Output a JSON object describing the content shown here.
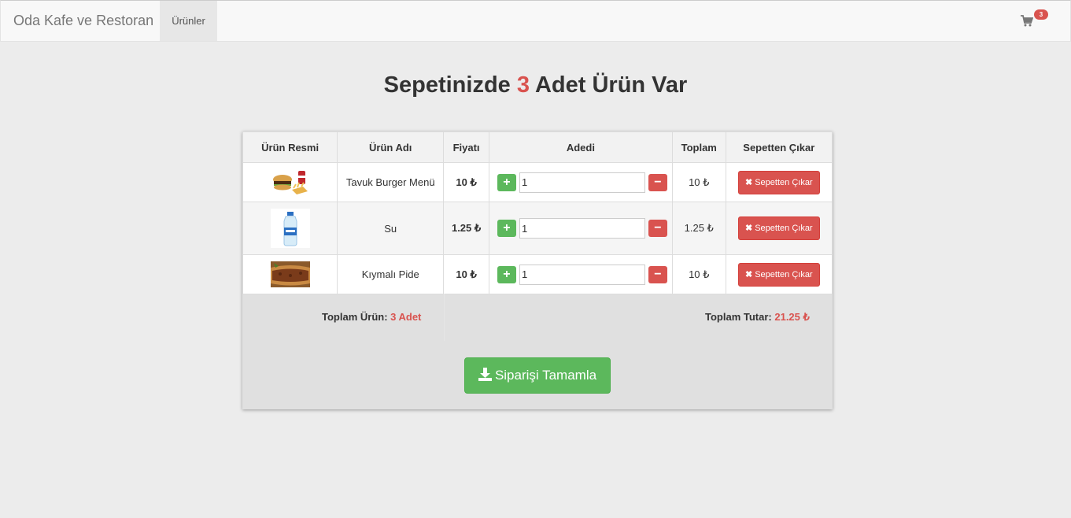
{
  "navbar": {
    "brand": "Oda Kafe ve Restoran",
    "nav_link": "Ürünler",
    "cart_icon": "shopping-cart-icon",
    "cart_count": "3"
  },
  "heading": {
    "prefix": "Sepetinizde ",
    "count": "3",
    "suffix": " Adet Ürün Var"
  },
  "table": {
    "headers": [
      "Ürün Resmi",
      "Ürün Adı",
      "Fiyatı",
      "Adedi",
      "Toplam",
      "Sepetten Çıkar"
    ],
    "rows": [
      {
        "image": "burger-menu-image",
        "name": "Tavuk Burger Menü",
        "price": "10 ₺",
        "qty": "1",
        "total": "10 ₺",
        "remove_label": "Sepetten Çıkar"
      },
      {
        "image": "water-bottle-image",
        "name": "Su",
        "price": "1.25 ₺",
        "qty": "1",
        "total": "1.25 ₺",
        "remove_label": "Sepetten Çıkar"
      },
      {
        "image": "pide-image",
        "name": "Kıymalı Pide",
        "price": "10 ₺",
        "qty": "1",
        "total": "10 ₺",
        "remove_label": "Sepetten Çıkar"
      }
    ]
  },
  "summary": {
    "total_items_label": "Toplam Ürün: ",
    "total_items_value": "3 Adet",
    "total_price_label": "Toplam Tutar: ",
    "total_price_value": "21.25 ₺"
  },
  "complete_button": "Siparişi Tamamla",
  "colors": {
    "accent_red": "#d9534f",
    "accent_green": "#5cb85c",
    "background": "#ececec"
  }
}
